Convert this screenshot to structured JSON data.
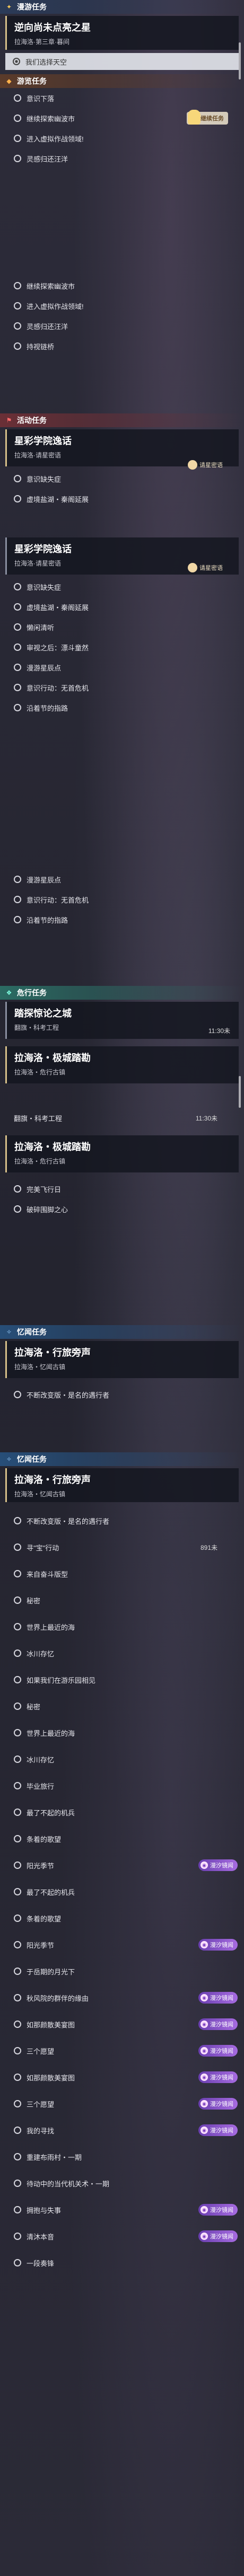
{
  "world": {
    "header": "漫游任务",
    "quest_title": "逆向尚未点亮之星",
    "quest_sub": "拉海洛·第三章·暮间",
    "tracked": "我们选择天空"
  },
  "tour": {
    "header": "游览任务",
    "items1": [
      "意识下落",
      "继续探索幽波市",
      "进入虚拟作战领域!",
      "灵感归还汪洋"
    ],
    "tag": "继续任务",
    "items2": [
      "继续探索幽波市",
      "进入虚拟作战领域!",
      "灵感归还汪洋",
      "持视链桥"
    ]
  },
  "act": {
    "header": "活动任务",
    "card1": {
      "title": "星彩学院逸话",
      "sub": "拉海洛·请星密语"
    },
    "hint1": "请星密语",
    "items1": [
      "意识缺失症",
      "虚境盐湖・秦阁延展"
    ],
    "card2": {
      "title": "星彩学院逸话",
      "sub": "拉海洛·请星密语"
    },
    "hint2": "请星密语",
    "items2": [
      "意识缺失症",
      "虚境盐湖・秦阁延展",
      "懒闲清听",
      "审视之后：漂斗童然",
      "漫游星辰点",
      "意识行动：无首危机",
      "沿着节的指路"
    ],
    "items3": [
      "漫游星辰点",
      "意识行动：无首危机",
      "沿着节的指路"
    ]
  },
  "risk": {
    "header": "危行任务",
    "card1": {
      "title": "踏探惊论之城",
      "sub": "翻旗・科考工程",
      "time": "11:30未"
    },
    "card2": {
      "title": "拉海洛・极城踏勘",
      "sub": "拉海洛・危行古镇"
    },
    "row1_label": "翻旗・科考工程",
    "row1_time": "11:30未",
    "card3": {
      "title": "拉海洛・极城踏勘",
      "sub": "拉海洛・危行古镇"
    },
    "items": [
      "完美飞行日",
      "破碎围脚之心"
    ]
  },
  "mem1": {
    "header": "忆闻任务",
    "card": {
      "title": "拉海洛・行旅旁声",
      "sub": "拉海洛・忆闻古镇"
    },
    "items": [
      "不断改变版・是名的遇行者"
    ]
  },
  "mem2": {
    "header": "忆闻任务",
    "card": {
      "title": "拉海洛・行旅旁声",
      "sub": "拉海洛・忆闻古镇"
    },
    "items": [
      {
        "label": "不断改变版・是名的遇行者"
      },
      {
        "label": "寻\"宝\"行动",
        "num": "891未"
      },
      {
        "label": "来自奋斗版型"
      },
      {
        "label": "秘密"
      },
      {
        "label": "世界上最近的海"
      },
      {
        "label": "冰川存忆"
      },
      {
        "label": "如果我们在游乐园相见"
      },
      {
        "label": "秘密"
      },
      {
        "label": "世界上最近的海"
      },
      {
        "label": "冰川存忆"
      },
      {
        "label": "毕业旅行"
      },
      {
        "label": "最了不起的机兵"
      },
      {
        "label": "条着的歌望"
      },
      {
        "label": "阳光季节",
        "badge": "漫汐镜闻"
      },
      {
        "label": "最了不起的机兵"
      },
      {
        "label": "条着的歌望"
      },
      {
        "label": "阳光季节",
        "badge": "漫汐镜闻"
      },
      {
        "label": "于岳期的月光下"
      },
      {
        "label": "秋风院的群伴的缘由",
        "badge": "漫汐镜闻"
      },
      {
        "label": "如那颜散美宴图",
        "badge": "漫汐镜闻"
      },
      {
        "label": "三个愿望",
        "badge": "漫汐镜闻"
      },
      {
        "label": "如那颜散美宴图",
        "badge": "漫汐镜闻"
      },
      {
        "label": "三个愿望",
        "badge": "漫汐镜闻"
      },
      {
        "label": "我的寻找",
        "badge": "漫汐镜闻"
      },
      {
        "label": "重建布雨村・一期"
      },
      {
        "label": "待动中的当代机关术・一期"
      },
      {
        "label": "拥抱与失事",
        "badge": "漫汐镜闻"
      },
      {
        "label": "清沐本音",
        "badge": "漫汐镜闻"
      },
      {
        "label": "一段奏锋"
      }
    ]
  },
  "badge_icon": "mask-icon",
  "colors": {
    "accent_gold": "#d7c08a",
    "badge_purple": "#8a55cc",
    "teal": "#2b6b63"
  }
}
